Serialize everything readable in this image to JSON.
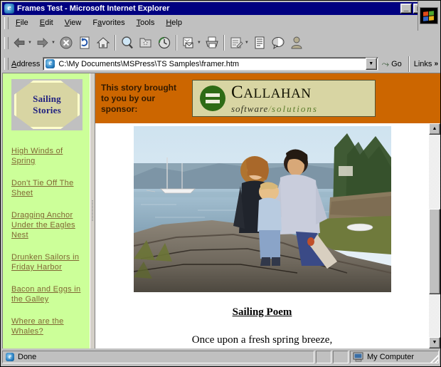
{
  "window": {
    "title": "Frames Test - Microsoft Internet Explorer",
    "icon": "ie-document-icon",
    "minimize_label": "_",
    "maximize_label": "□",
    "close_label": "✕"
  },
  "menubar": {
    "items": [
      {
        "label": "File",
        "accel": "F",
        "rest": "ile"
      },
      {
        "label": "Edit",
        "accel": "E",
        "rest": "dit"
      },
      {
        "label": "View",
        "accel": "V",
        "rest": "iew"
      },
      {
        "label": "Favorites",
        "accel": "F",
        "rest": "avorites"
      },
      {
        "label": "Tools",
        "accel": "T",
        "rest": "ools"
      },
      {
        "label": "Help",
        "accel": "H",
        "rest": "elp"
      }
    ],
    "brand_logo": "windows-flag-logo"
  },
  "toolbar": {
    "buttons": [
      {
        "name": "back-button",
        "icon": "back-arrow-icon",
        "dropdown": true
      },
      {
        "name": "forward-button",
        "icon": "forward-arrow-icon",
        "dropdown": true
      },
      {
        "name": "stop-button",
        "icon": "stop-icon",
        "dropdown": false
      },
      {
        "name": "refresh-button",
        "icon": "refresh-icon",
        "dropdown": false
      },
      {
        "name": "home-button",
        "icon": "home-icon",
        "dropdown": false
      },
      {
        "name": "search-button",
        "icon": "search-icon",
        "dropdown": false
      },
      {
        "name": "favorites-button",
        "icon": "favorites-star-icon",
        "dropdown": false
      },
      {
        "name": "history-button",
        "icon": "history-clock-icon",
        "dropdown": false
      },
      {
        "name": "mail-button",
        "icon": "mail-icon",
        "dropdown": true
      },
      {
        "name": "print-button",
        "icon": "printer-icon",
        "dropdown": false
      },
      {
        "name": "edit-button",
        "icon": "edit-page-icon",
        "dropdown": true
      },
      {
        "name": "discuss-button",
        "icon": "discuss-page-icon",
        "dropdown": false
      },
      {
        "name": "messenger-button",
        "icon": "messenger-balloon-icon",
        "dropdown": false
      },
      {
        "name": "person-button",
        "icon": "person-icon",
        "dropdown": false
      }
    ]
  },
  "address": {
    "label": "Address",
    "label_accel": "A",
    "label_rest": "ddress",
    "icon": "ie-page-icon",
    "value": "C:\\My Documents\\MSPress\\TS Samples\\framer.htm",
    "placeholder": "",
    "dropdown_icon": "chevron-down-icon",
    "go_label": "Go",
    "go_icon": "go-arrow-icon",
    "links_label": "Links",
    "links_chevron": "»"
  },
  "left_frame": {
    "background_color": "#ccff99",
    "logo": {
      "line1": "Sailing",
      "line2": "Stories",
      "shape": "octagon",
      "fill_color": "#d8d5a3",
      "border_color": "#ffffcc",
      "text_color": "#202080"
    },
    "links": [
      "High Winds of Spring",
      "Don't Tie Off The Sheet",
      "Dragging Anchor Under the Eagles Nest",
      "Drunken Sailors in Friday Harbor",
      "Bacon and Eggs in the Galley",
      "Where are the Whales?"
    ],
    "link_color": "#806633"
  },
  "banner": {
    "background_color": "#cc6600",
    "text": "This story brought to you by our sponsor:",
    "sponsor": {
      "name_part1": "C",
      "name_part2": "ALLAHAN",
      "tagline_word1": "software",
      "tagline_slash": "/",
      "tagline_word2": "solutions",
      "logo_icon": "callahan-equals-circle-icon",
      "panel_color": "#d8d5a3",
      "circle_color": "#2e6b16"
    }
  },
  "content": {
    "photo_alt": "family-on-rocky-shore-with-sailboat-photo",
    "poem_title": "Sailing Poem",
    "poem_line1": "Once upon a fresh spring breeze,"
  },
  "scrollbar": {
    "up_icon": "▲",
    "down_icon": "▼"
  },
  "statusbar": {
    "status_text": "Done",
    "status_icon": "ie-page-icon",
    "zone_text": "My Computer",
    "zone_icon": "my-computer-icon"
  }
}
